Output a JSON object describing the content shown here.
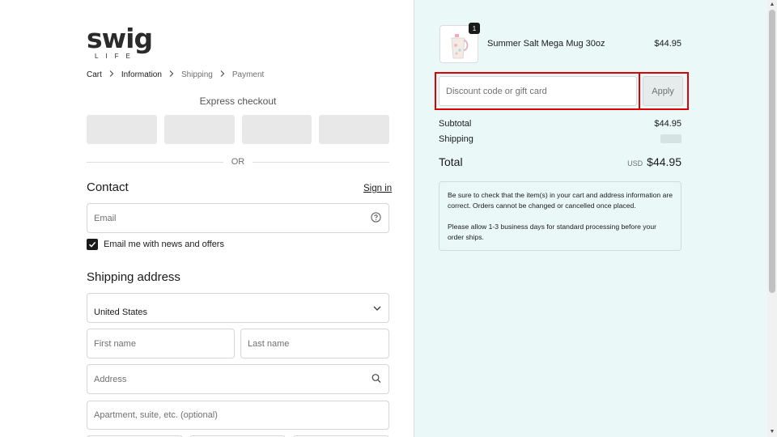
{
  "brand": {
    "logo_text": "swig",
    "logo_sub": "LIFE"
  },
  "breadcrumb": {
    "items": [
      "Cart",
      "Information",
      "Shipping",
      "Payment"
    ],
    "separator": "›"
  },
  "express": {
    "title": "Express checkout",
    "divider": "OR"
  },
  "contact": {
    "title": "Contact",
    "sign_in": "Sign in",
    "email_placeholder": "Email",
    "newsletter_label": "Email me with news and offers",
    "newsletter_checked": true
  },
  "shipping": {
    "title": "Shipping address",
    "country": "United States",
    "first_name_placeholder": "First name",
    "last_name_placeholder": "Last name",
    "address_placeholder": "Address",
    "apartment_placeholder": "Apartment, suite, etc. (optional)"
  },
  "order": {
    "item": {
      "name": "Summer Salt Mega Mug 30oz",
      "price": "$44.95",
      "quantity": "1"
    },
    "discount_placeholder": "Discount code or gift card",
    "apply_label": "Apply",
    "subtotal_label": "Subtotal",
    "subtotal_value": "$44.95",
    "shipping_label": "Shipping",
    "total_label": "Total",
    "currency": "USD",
    "total_value": "$44.95",
    "note_1": "Be sure to check that the item(s) in your cart and address information are correct. Orders cannot be changed or cancelled once placed.",
    "note_2": "Please allow 1-3 business days for standard processing before your order ships."
  },
  "colors": {
    "accent": "#1fb0c6",
    "summary_bg": "#eaf8f8",
    "highlight": "#e00000"
  }
}
